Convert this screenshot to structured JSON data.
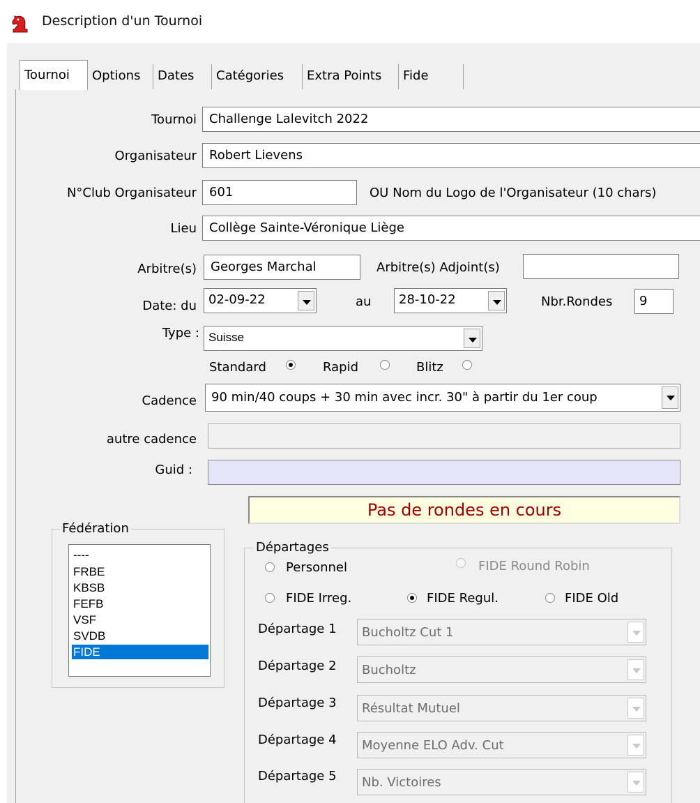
{
  "window": {
    "title": "Description d'un Tournoi",
    "icon": "knight-icon"
  },
  "tabs": [
    {
      "label": "Tournoi",
      "active": true
    },
    {
      "label": "Options"
    },
    {
      "label": "Dates"
    },
    {
      "label": "Catégories"
    },
    {
      "label": "Extra Points"
    },
    {
      "label": "Fide"
    }
  ],
  "form": {
    "tournoi": {
      "label": "Tournoi",
      "value": "Challenge Lalevitch 2022"
    },
    "organisateur": {
      "label": "Organisateur",
      "value": "Robert Lievens"
    },
    "club": {
      "label": "N°Club Organisateur",
      "value": "601",
      "hint": "OU Nom du Logo de l'Organisateur (10 chars)"
    },
    "lieu": {
      "label": "Lieu",
      "value": "Collège Sainte-Véronique Liège"
    },
    "arbitre": {
      "label": "Arbitre(s)",
      "value": "Georges Marchal"
    },
    "adjoint": {
      "label": "Arbitre(s) Adjoint(s)",
      "value": ""
    },
    "date_du": {
      "label": "Date: du",
      "value": "02-09-22"
    },
    "date_au": {
      "label": "au",
      "value": "28-10-22"
    },
    "rondes": {
      "label": "Nbr.Rondes",
      "value": "9"
    },
    "type": {
      "label": "Type :",
      "value": "Suisse"
    },
    "speed": {
      "standard": {
        "label": "Standard",
        "selected": true
      },
      "rapid": {
        "label": "Rapid",
        "selected": false
      },
      "blitz": {
        "label": "Blitz",
        "selected": false
      }
    },
    "cadence": {
      "label": "Cadence",
      "value": "90 min/40 coups + 30 min avec incr. 30\" à partir du 1er coup"
    },
    "autre_cadence": {
      "label": "autre cadence",
      "value": ""
    },
    "guid": {
      "label": "Guid :",
      "value": ""
    }
  },
  "status": "Pas de rondes en cours",
  "federation": {
    "title": "Fédération",
    "items": [
      "----",
      "FRBE",
      "KBSB",
      "FEFB",
      "VSF",
      "SVDB",
      "FIDE"
    ],
    "selected": "FIDE"
  },
  "departages": {
    "title": "Départages",
    "options": {
      "personnel": {
        "label": "Personnel",
        "selected": false,
        "enabled": true
      },
      "round_robin": {
        "label": "FIDE Round Robin",
        "selected": false,
        "enabled": false
      },
      "irreg": {
        "label": "FIDE Irreg.",
        "selected": false,
        "enabled": true
      },
      "regul": {
        "label": "FIDE Regul.",
        "selected": true,
        "enabled": true
      },
      "old": {
        "label": "FIDE Old",
        "selected": false,
        "enabled": true
      }
    },
    "rows": [
      {
        "label": "Départage 1",
        "value": "Bucholtz Cut 1"
      },
      {
        "label": "Départage 2",
        "value": "Bucholtz"
      },
      {
        "label": "Départage 3",
        "value": "Résultat Mutuel"
      },
      {
        "label": "Départage 4",
        "value": "Moyenne ELO Adv. Cut"
      },
      {
        "label": "Départage 5",
        "value": "Nb. Victoires"
      }
    ]
  },
  "colors": {
    "status_text": "#a00000",
    "selection": "#0078d7",
    "guid_bg": "#e5e5fa",
    "status_bg": "#ffffe1"
  }
}
